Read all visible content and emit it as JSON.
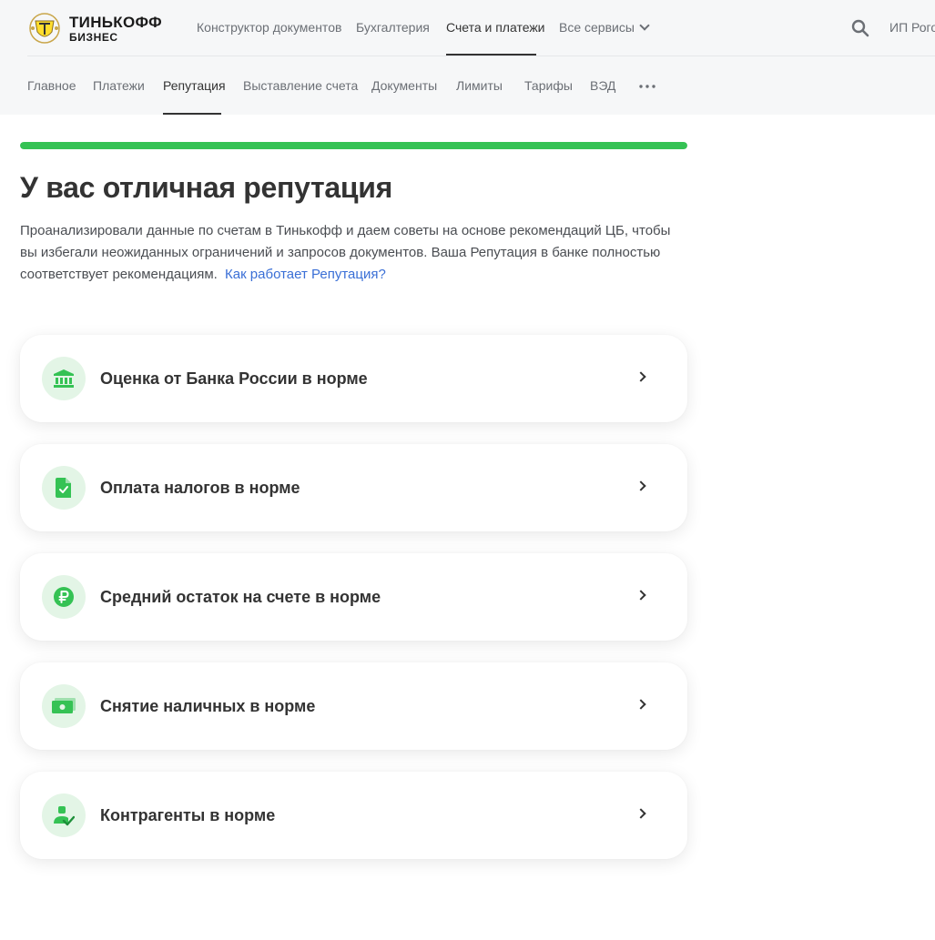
{
  "brand": {
    "name": "ТИНЬКОФФ",
    "sub": "БИЗНЕС"
  },
  "top_nav": [
    {
      "label": "Конструктор документов"
    },
    {
      "label": "Бухгалтерия"
    },
    {
      "label": "Счета и платежи",
      "active": true
    },
    {
      "label": "Все сервисы"
    }
  ],
  "user": {
    "name": "ИП Рого"
  },
  "sub_nav": [
    {
      "label": "Главное"
    },
    {
      "label": "Платежи"
    },
    {
      "label": "Репутация",
      "active": true
    },
    {
      "label": "Выставление счета"
    },
    {
      "label": "Документы"
    },
    {
      "label": "Лимиты"
    },
    {
      "label": "Тарифы"
    },
    {
      "label": "ВЭД"
    }
  ],
  "reputation": {
    "progress": 1.0,
    "title": "У вас отличная репутация",
    "description": "Проанализировали данные по счетам в Тинькофф и даем советы на основе рекомендаций ЦБ, чтобы вы избегали неожиданных ограничений и запросов документов. Ваша Репутация в банке полностью соответствует рекомендациям.",
    "link": "Как работает Репутация?"
  },
  "cards": [
    {
      "label": "Оценка от Банка России в норме",
      "icon": "bank-icon"
    },
    {
      "label": "Оплата налогов в норме",
      "icon": "tax-document-icon"
    },
    {
      "label": "Средний остаток на счете в норме",
      "icon": "ruble-icon"
    },
    {
      "label": "Снятие наличных в норме",
      "icon": "cash-icon"
    },
    {
      "label": "Контрагенты в норме",
      "icon": "counterparty-icon"
    }
  ],
  "colors": {
    "accent_green": "#35c254",
    "icon_bg": "#e3f5e6",
    "link": "#3a6fd6",
    "header_bg": "#f6f7f8"
  }
}
